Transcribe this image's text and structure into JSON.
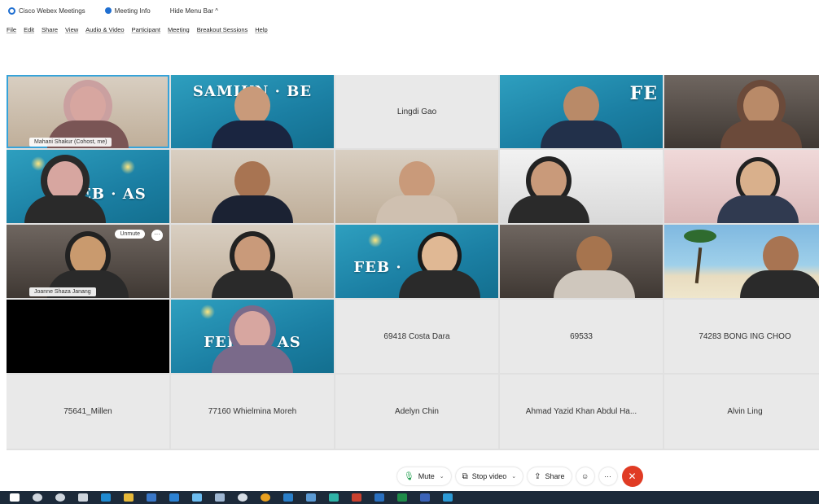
{
  "titlebar": {
    "app_name": "Cisco Webex Meetings",
    "meeting_info": "Meeting Info",
    "hide_menu": "Hide Menu Bar ^"
  },
  "menu": [
    "File",
    "Edit",
    "Share",
    "View",
    "Audio & Video",
    "Participant",
    "Meeting",
    "Breakout Sessions",
    "Help"
  ],
  "tiles": [
    {
      "type": "video",
      "bg": "room",
      "label": "Mahani Shakur (Cohost, me)"
    },
    {
      "type": "video",
      "bg": "teal",
      "banner": "SAMIUN · BE"
    },
    {
      "type": "name",
      "name": "Lingdi Gao"
    },
    {
      "type": "video",
      "bg": "teal",
      "banner": "FE"
    },
    {
      "type": "video",
      "bg": "dark"
    },
    {
      "type": "video",
      "bg": "teal",
      "banner": "FEB · AS"
    },
    {
      "type": "video",
      "bg": "room"
    },
    {
      "type": "video",
      "bg": "room"
    },
    {
      "type": "video",
      "bg": "white"
    },
    {
      "type": "video",
      "bg": "pink"
    },
    {
      "type": "video",
      "bg": "dark",
      "label": "Joanne Shaza Janang",
      "unmute": "Unmute",
      "more": "···"
    },
    {
      "type": "video",
      "bg": "room"
    },
    {
      "type": "video",
      "bg": "teal",
      "banner": "FEB ·"
    },
    {
      "type": "video",
      "bg": "dark"
    },
    {
      "type": "video",
      "bg": "beach"
    },
    {
      "type": "black"
    },
    {
      "type": "video",
      "bg": "teal",
      "banner": "FEB · U   AS"
    },
    {
      "type": "name",
      "name": "69418 Costa Dara"
    },
    {
      "type": "name",
      "name": "69533"
    },
    {
      "type": "name",
      "name": "74283 BONG ING CHOO"
    },
    {
      "type": "name",
      "name": "75641_Millen"
    },
    {
      "type": "name",
      "name": "77160 Whielmina Moreh"
    },
    {
      "type": "name",
      "name": "Adelyn Chin"
    },
    {
      "type": "name",
      "name": "Ahmad Yazid Khan Abdul Ha..."
    },
    {
      "type": "name",
      "name": "Alvin Ling"
    }
  ],
  "controls": {
    "mute": "Mute",
    "stop_video": "Stop video",
    "share": "Share",
    "more": "···",
    "end": "✕"
  },
  "colors": {
    "accent": "#1f6fd1",
    "end_call": "#e03b24",
    "taskbar": "#1c2a3a",
    "tile_bg": "#e9e9e9"
  }
}
